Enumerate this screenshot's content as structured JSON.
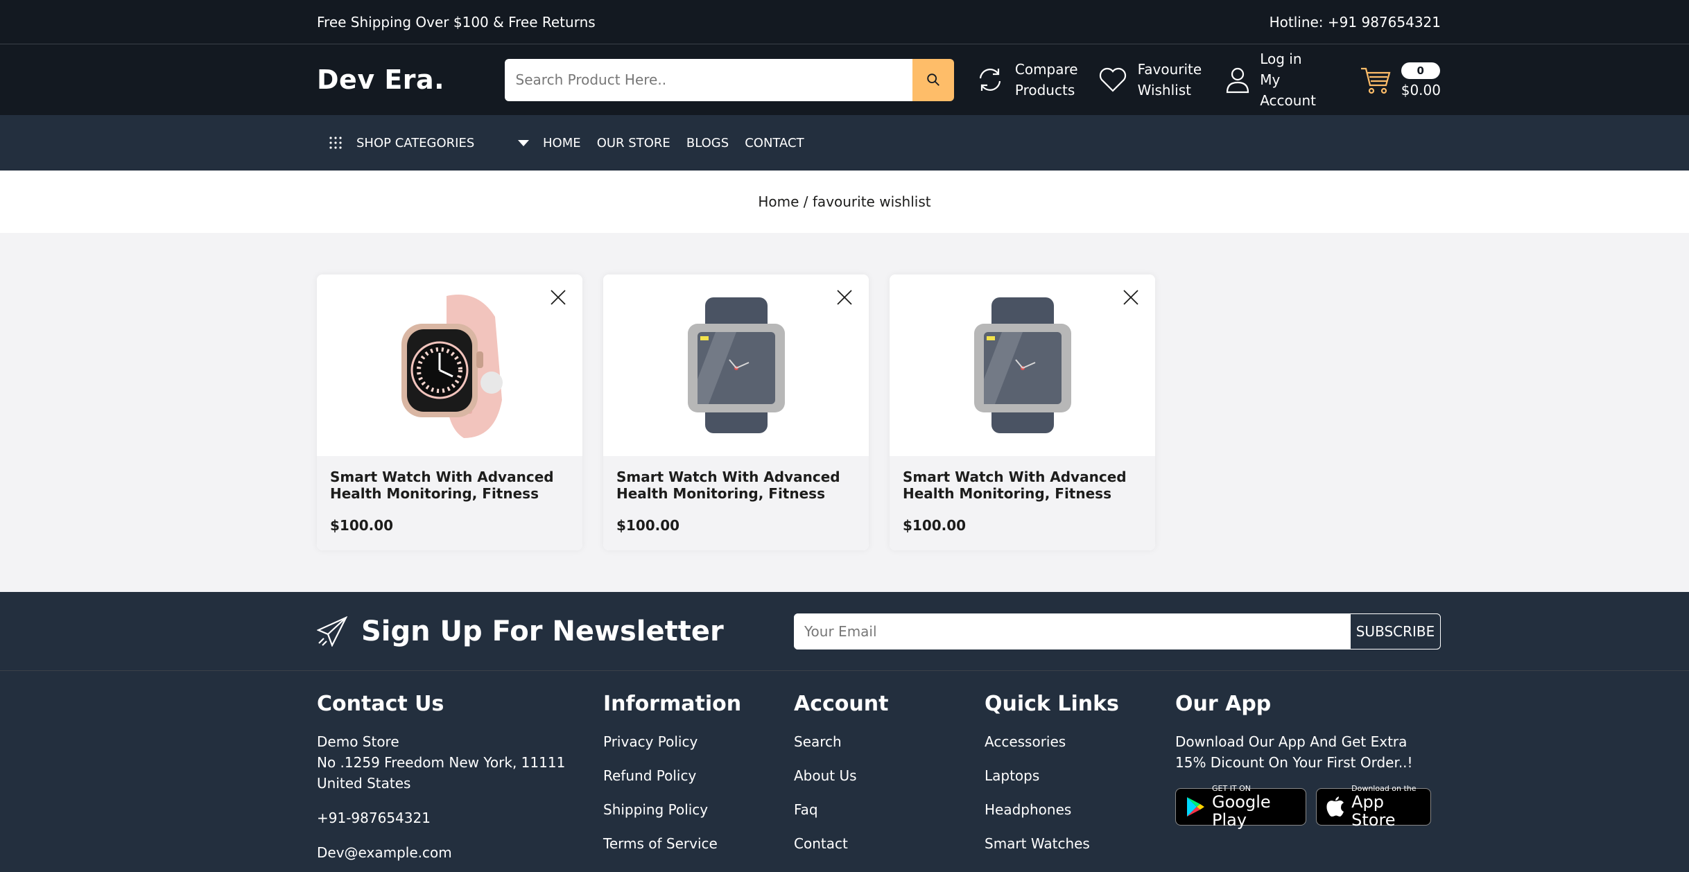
{
  "topbar": {
    "left": "Free Shipping Over $100 & Free Returns",
    "right": "Hotline: +91 987654321"
  },
  "header": {
    "logo": "Dev Era.",
    "search_placeholder": "Search Product Here..",
    "compare_line1": "Compare",
    "compare_line2": "Products",
    "wish_line1": "Favourite",
    "wish_line2": "Wishlist",
    "login_line1": "Log in",
    "login_line2": "My Account",
    "cart_count": "0",
    "cart_total": "$0.00"
  },
  "nav": {
    "shop_categories": "SHOP CATEGORIES",
    "items": [
      "HOME",
      "OUR STORE",
      "BLOGS",
      "CONTACT"
    ]
  },
  "breadcrumb": "Home / favourite wishlist",
  "products": [
    {
      "title": "Smart Watch With Advanced Health Monitoring, Fitness",
      "price": "$100.00",
      "image": "pink-apple-watch"
    },
    {
      "title": "Smart Watch With Advanced Health Monitoring, Fitness",
      "price": "$100.00",
      "image": "grey-smart-watch"
    },
    {
      "title": "Smart Watch With Advanced Health Monitoring, Fitness",
      "price": "$100.00",
      "image": "grey-smart-watch"
    }
  ],
  "newsletter": {
    "title": "Sign Up For Newsletter",
    "email_placeholder": "Your Email",
    "subscribe": "SUBSCRIBE"
  },
  "footer": {
    "contact": {
      "heading": "Contact Us",
      "store": "Demo Store",
      "address1": "No .1259 Freedom New York, 11111",
      "address2": "United States",
      "phone": "+91-987654321",
      "email": "Dev@example.com"
    },
    "information": {
      "heading": "Information",
      "links": [
        "Privacy Policy",
        "Refund Policy",
        "Shipping Policy",
        "Terms of Service"
      ]
    },
    "account": {
      "heading": "Account",
      "links": [
        "Search",
        "About Us",
        "Faq",
        "Contact"
      ]
    },
    "quick_links": {
      "heading": "Quick Links",
      "links": [
        "Accessories",
        "Laptops",
        "Headphones",
        "Smart Watches"
      ]
    },
    "app": {
      "heading": "Our App",
      "text": "Download Our App And Get Extra 15% Dicount On Your First Order..!",
      "google_small": "GET IT ON",
      "google_big": "Google Play",
      "apple_small": "Download on the",
      "apple_big": "App Store"
    }
  },
  "colors": {
    "dark": "#131921",
    "navy": "#232f3e",
    "accent": "#febd69",
    "page_bg": "#f3f3f5"
  }
}
